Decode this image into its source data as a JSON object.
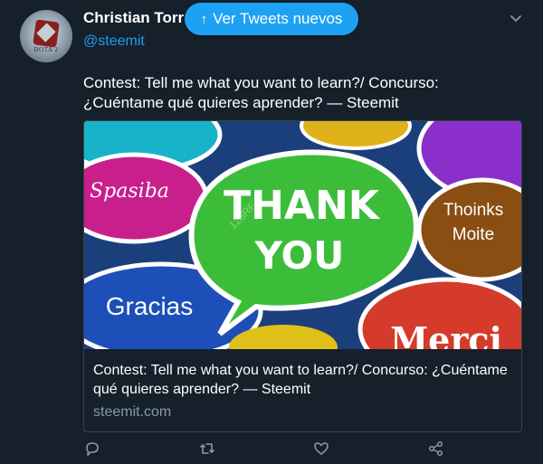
{
  "author": {
    "name": "Christian Torr",
    "handle": "@steemit",
    "avatar_text": "DOTA 2"
  },
  "new_tweets_button": {
    "label": "Ver Tweets nuevos",
    "icon": "arrow-up-icon"
  },
  "tweet": {
    "text": "Contest: Tell me what you want to learn?/ Concurso: ¿Cuéntame qué quieres aprender? — Steemit"
  },
  "card": {
    "image_words": {
      "thank": "THANK",
      "you": "YOU",
      "spasiba": "Spasiba",
      "thoinks": "Thoinks",
      "moite": "Moite",
      "gracias": "Gracias",
      "merci": "Merci"
    },
    "watermark": "123RF",
    "title": "Contest: Tell me what you want to learn?/ Concurso: ¿Cuéntame qué quieres aprender? — Steemit",
    "domain": "steemit.com"
  },
  "actions": [
    "reply-icon",
    "retweet-icon",
    "like-icon",
    "share-icon"
  ],
  "colors": {
    "background": "#15202b",
    "accent": "#1da1f2",
    "muted": "#8899a6",
    "border": "#38444d"
  }
}
